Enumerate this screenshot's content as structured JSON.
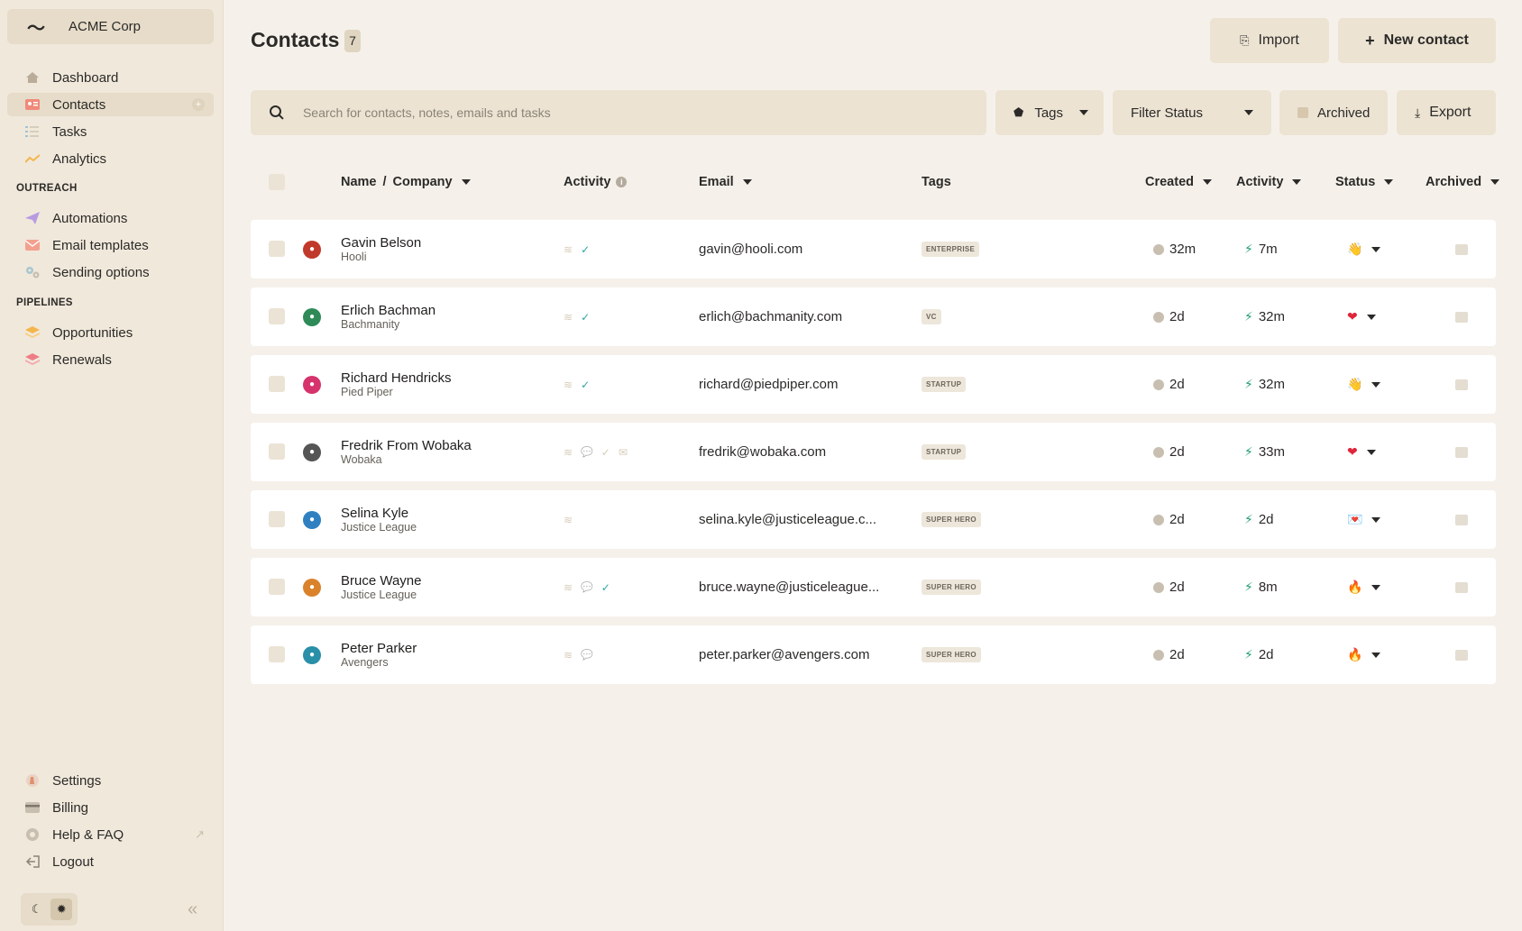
{
  "org": {
    "name": "ACME Corp"
  },
  "nav": {
    "main": [
      {
        "label": "Dashboard",
        "icon": "home-icon"
      },
      {
        "label": "Contacts",
        "icon": "contacts-icon",
        "active": true
      },
      {
        "label": "Tasks",
        "icon": "tasks-icon"
      },
      {
        "label": "Analytics",
        "icon": "analytics-icon"
      }
    ],
    "outreach_title": "OUTREACH",
    "outreach": [
      {
        "label": "Automations",
        "icon": "paper-plane-icon"
      },
      {
        "label": "Email templates",
        "icon": "envelope-icon"
      },
      {
        "label": "Sending options",
        "icon": "gears-icon"
      }
    ],
    "pipelines_title": "PIPELINES",
    "pipelines": [
      {
        "label": "Opportunities",
        "icon": "stack-orange-icon"
      },
      {
        "label": "Renewals",
        "icon": "stack-red-icon"
      }
    ],
    "bottom": [
      {
        "label": "Settings",
        "icon": "settings-icon"
      },
      {
        "label": "Billing",
        "icon": "credit-card-icon"
      },
      {
        "label": "Help & FAQ",
        "icon": "help-icon"
      },
      {
        "label": "Logout",
        "icon": "logout-icon"
      }
    ]
  },
  "header": {
    "title": "Contacts",
    "count": "7",
    "import_label": "Import",
    "new_contact_label": "New contact"
  },
  "toolbar": {
    "search_placeholder": "Search for contacts, notes, emails and tasks",
    "tags_label": "Tags",
    "filter_status_label": "Filter Status",
    "archived_label": "Archived",
    "export_label": "Export"
  },
  "columns": {
    "name": "Name",
    "sep": "/",
    "company": "Company",
    "activity": "Activity",
    "email": "Email",
    "tags": "Tags",
    "created": "Created",
    "last_activity": "Activity",
    "status": "Status",
    "archived": "Archived"
  },
  "contacts": [
    {
      "name": "Gavin Belson",
      "company": "Hooli",
      "email": "gavin@hooli.com",
      "tag": "ENTERPRISE",
      "created": "32m",
      "activity": "7m",
      "status_icon": "👋",
      "avatar_color": "#c0392b",
      "activity_icons": [
        "stack",
        "check"
      ]
    },
    {
      "name": "Erlich Bachman",
      "company": "Bachmanity",
      "email": "erlich@bachmanity.com",
      "tag": "VC",
      "created": "2d",
      "activity": "32m",
      "status_icon": "❤",
      "avatar_color": "#2e8b57",
      "activity_icons": [
        "stack",
        "check"
      ]
    },
    {
      "name": "Richard Hendricks",
      "company": "Pied Piper",
      "email": "richard@piedpiper.com",
      "tag": "STARTUP",
      "created": "2d",
      "activity": "32m",
      "status_icon": "👋",
      "avatar_color": "#d6336c",
      "activity_icons": [
        "stack",
        "check"
      ]
    },
    {
      "name": "Fredrik From Wobaka",
      "company": "Wobaka",
      "email": "fredrik@wobaka.com",
      "tag": "STARTUP",
      "created": "2d",
      "activity": "33m",
      "status_icon": "❤",
      "avatar_color": "#555555",
      "activity_icons": [
        "stack",
        "chat",
        "check-dim",
        "mail"
      ]
    },
    {
      "name": "Selina Kyle",
      "company": "Justice League",
      "email": "selina.kyle@justiceleague.c...",
      "tag": "SUPER HERO",
      "created": "2d",
      "activity": "2d",
      "status_icon": "💌",
      "avatar_color": "#2f80c0",
      "activity_icons": [
        "stack"
      ]
    },
    {
      "name": "Bruce Wayne",
      "company": "Justice League",
      "email": "bruce.wayne@justiceleague...",
      "tag": "SUPER HERO",
      "created": "2d",
      "activity": "8m",
      "status_icon": "🔥",
      "avatar_color": "#d9822b",
      "activity_icons": [
        "stack",
        "chat",
        "check"
      ]
    },
    {
      "name": "Peter Parker",
      "company": "Avengers",
      "email": "peter.parker@avengers.com",
      "tag": "SUPER HERO",
      "created": "2d",
      "activity": "2d",
      "status_icon": "🔥",
      "avatar_color": "#2a8fa8",
      "activity_icons": [
        "stack",
        "chat"
      ]
    }
  ]
}
